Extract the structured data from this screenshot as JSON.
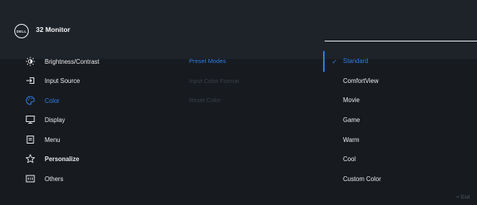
{
  "header": {
    "logo_text": "DELL",
    "title": "32 Monitor"
  },
  "menu": {
    "items": [
      {
        "label": "Brightness/Contrast",
        "icon": "brightness-icon"
      },
      {
        "label": "Input Source",
        "icon": "input-source-icon"
      },
      {
        "label": "Color",
        "icon": "color-palette-icon",
        "active": true
      },
      {
        "label": "Display",
        "icon": "display-icon"
      },
      {
        "label": "Menu",
        "icon": "menu-icon"
      },
      {
        "label": "Personalize",
        "icon": "star-icon"
      },
      {
        "label": "Others",
        "icon": "others-icon"
      }
    ]
  },
  "submenu": {
    "items": [
      {
        "label": "Preset Modes",
        "state": "active"
      },
      {
        "label": "Input Color Format",
        "state": "disabled"
      },
      {
        "label": "Reset Color",
        "state": "disabled"
      }
    ]
  },
  "options": {
    "items": [
      "Standard",
      "ComfortView",
      "Movie",
      "Game",
      "Warm",
      "Cool",
      "Custom Color"
    ],
    "selected": "Standard",
    "check_glyph": "✓"
  },
  "footer": {
    "exit_label": "<  Exit"
  },
  "colors": {
    "accent": "#2f7de1",
    "background": "#171b20",
    "header": "#1e232a"
  }
}
